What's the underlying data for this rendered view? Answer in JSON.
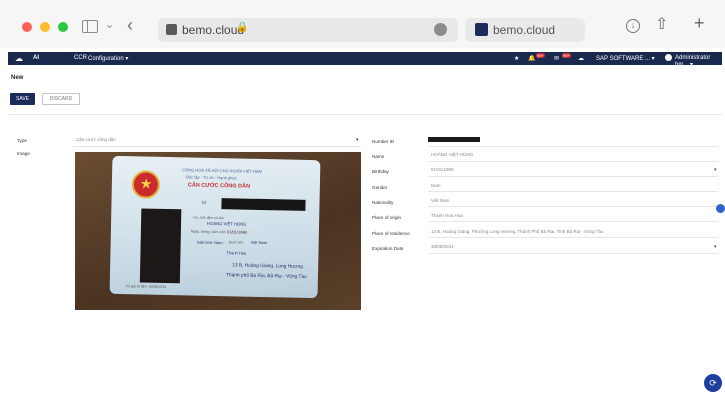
{
  "browser": {
    "url": "bemo.cloud",
    "tab_title": "bemo.cloud",
    "icons": [
      "sidebar-toggle-icon",
      "chevron-down-icon",
      "back-arrow-icon",
      "lock-icon",
      "download-icon",
      "share-icon",
      "plus-icon"
    ]
  },
  "shell": {
    "app": "AI",
    "ccr": "CCR",
    "config": "Configuration ▾",
    "badge_1": "99+",
    "badge_2": "99+",
    "company": "SAP SOFTWARE ... ▾",
    "user": "Administrator bm... ▾"
  },
  "page": {
    "title": "New",
    "save": "SAVE",
    "discard": "DISCARD"
  },
  "left_form": {
    "type_label": "Type",
    "type_value": "Căn cước công dân",
    "image_label": "Image"
  },
  "id_card": {
    "header_1": "CỘNG HOÀ XÃ HỘI CHỦ NGHĨA VIỆT NAM",
    "header_2": "Độc lập - Tự do - Hạnh phúc",
    "title": "CĂN CƯỚC CÔNG DÂN",
    "id_label": "Số",
    "name_label": "Họ, chữ đệm và tên",
    "name": "HOÀNG VIỆT HÙNG",
    "dob_label": "Ngày, tháng, năm sinh",
    "dob": "01/01/1990",
    "sex": "Giới tính: Nam",
    "nationality_label": "Quốc tịch",
    "nationality": "Việt Nam",
    "origin": "Thanh Hóa",
    "residence_1": "13 B, Hoàng Giang, Long Hương",
    "residence_2": "Thành phố Bà Rịa, Bà Rịa - Vũng Tàu",
    "footer": "Có giá trị đến: 30/09/2034"
  },
  "right_form": {
    "fields": [
      {
        "label": "Number ID",
        "value": ""
      },
      {
        "label": "Name",
        "value": "HOÀNG VIỆT HÙNG"
      },
      {
        "label": "Birthday",
        "value": "01/01/1990"
      },
      {
        "label": "Gender",
        "value": "Nam"
      },
      {
        "label": "Nationality",
        "value": "Việt Nam"
      },
      {
        "label": "Place of origin",
        "value": "Thanh Hóa Hoa"
      },
      {
        "label": "Place of residence",
        "value": "13 B, Hoàng Giang, Phường Long Hương, Thành Phố Bà Rịa, Tỉnh Bà Rịa - Vũng Tàu"
      },
      {
        "label": "Expiration Date",
        "value": "30/09/2034"
      }
    ]
  },
  "colors": {
    "shell_bg": "#1a2a4f",
    "save_bg": "#1d2b59",
    "fab_bg": "#1e3fa0",
    "card_title": "#c23030"
  }
}
